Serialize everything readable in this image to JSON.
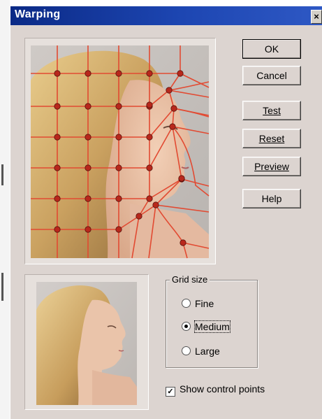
{
  "window": {
    "title": "Warping",
    "close_glyph": "×"
  },
  "buttons": {
    "ok": "OK",
    "cancel": "Cancel",
    "test": "Test",
    "reset": "Reset",
    "preview": "Preview",
    "help": "Help"
  },
  "grid_size": {
    "label": "Grid size",
    "options": [
      {
        "label": "Fine",
        "selected": false
      },
      {
        "label": "Medium",
        "selected": true
      },
      {
        "label": "Large",
        "selected": false
      }
    ]
  },
  "show_control_points": {
    "label": "Show control points",
    "checked": true,
    "check_glyph": "✓"
  },
  "colors": {
    "titlebar": "#0b2a86",
    "grid_line": "#e24a32",
    "control_point": "#b8281c",
    "dialog_bg": "#dcd4d0"
  },
  "icons": [
    "close-icon",
    "warped-face-image",
    "original-face-image"
  ]
}
